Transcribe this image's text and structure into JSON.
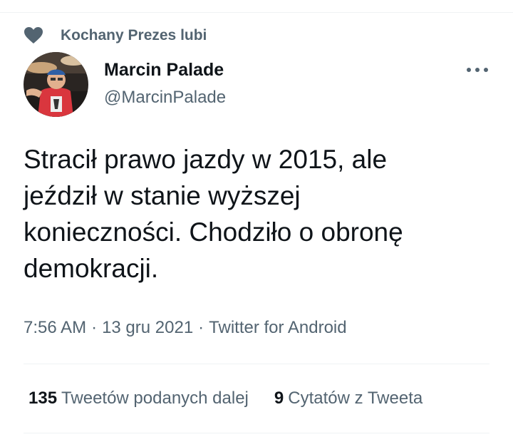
{
  "social_context": {
    "icon": "heart-icon",
    "text": "Kochany Prezes lubi"
  },
  "author": {
    "display_name": "Marcin Palade",
    "handle": "@MarcinPalade",
    "avatar_icon": "avatar-photo"
  },
  "more_icon": "more-icon",
  "tweet": {
    "text": "Stracił prawo jazdy w 2015, ale\njeździł w stanie wyższej\nkonieczności. Chodziło o obronę\ndemokracji."
  },
  "meta": {
    "time": "7:56 AM",
    "date": "13 gru 2021",
    "source": "Twitter for Android",
    "separator": "·"
  },
  "stats": {
    "retweets_count": "135",
    "retweets_label": "Tweetów podanych dalej",
    "quotes_count": "9",
    "quotes_label": "Cytatów z Tweeta"
  },
  "colors": {
    "text_primary": "#0f1419",
    "text_secondary": "#536471",
    "divider": "#eff3f4"
  }
}
